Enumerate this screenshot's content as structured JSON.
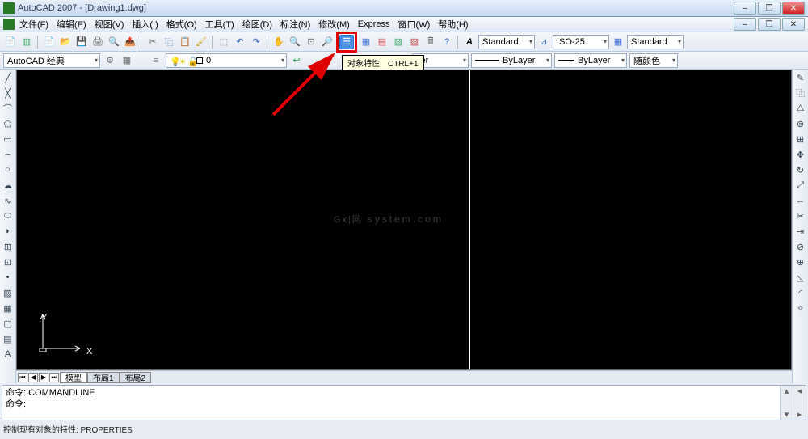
{
  "title": "AutoCAD 2007 - [Drawing1.dwg]",
  "menu": [
    "文件(F)",
    "编辑(E)",
    "视图(V)",
    "插入(I)",
    "格式(O)",
    "工具(T)",
    "绘图(D)",
    "标注(N)",
    "修改(M)",
    "Express",
    "窗口(W)",
    "帮助(H)"
  ],
  "workspace": "AutoCAD 经典",
  "layer_current": "0",
  "style_std": "Standard",
  "dim_style": "ISO-25",
  "table_style": "Standard",
  "linetype_suffix": "yer",
  "bylayer1": "ByLayer",
  "bylayer2": "ByLayer",
  "bycolor": "随颜色",
  "tooltip": "对象特性　CTRL+1",
  "watermark_main": "Gx|网",
  "watermark_sub": "system.com",
  "ucs_x": "X",
  "ucs_y": "Y",
  "tabs": {
    "model": "模型",
    "layout1": "布局1",
    "layout2": "布局2"
  },
  "cmd_line1": "命令: COMMANDLINE",
  "cmd_line2": "命令:",
  "status_text": "控制现有对象的特性: PROPERTIES"
}
